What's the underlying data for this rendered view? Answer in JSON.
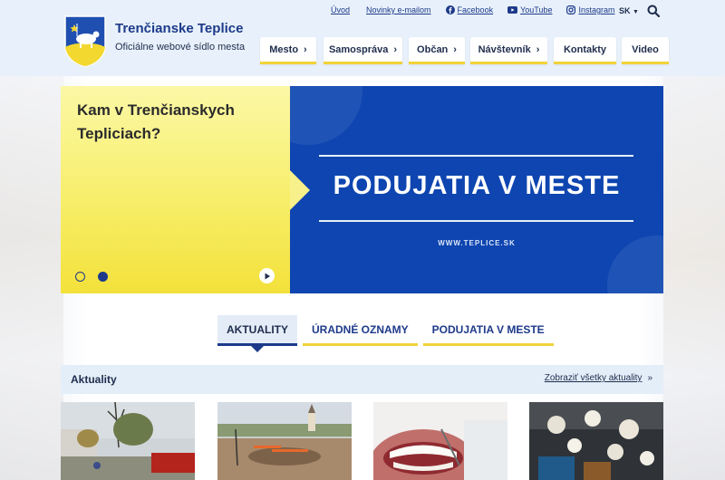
{
  "header": {
    "title": "Trenčianske Teplice",
    "subtitle": "Oficiálne webové sídlo mesta",
    "top_links": [
      "Úvod",
      "Novinky e-mailom",
      "Facebook",
      "YouTube",
      "Instagram"
    ],
    "language": "SK"
  },
  "nav": {
    "items": [
      {
        "label": "Mesto",
        "has_submenu": true
      },
      {
        "label": "Samospráva",
        "has_submenu": true
      },
      {
        "label": "Občan",
        "has_submenu": true
      },
      {
        "label": "Návštevník",
        "has_submenu": true
      },
      {
        "label": "Kontakty",
        "has_submenu": false
      },
      {
        "label": "Video",
        "has_submenu": false
      }
    ]
  },
  "hero": {
    "heading": "Kam v Trenčianskych Tepliciach?",
    "banner_title": "PODUJATIA V MESTE",
    "banner_url": "WWW.TEPLICE.SK",
    "slides": 2,
    "active_slide": 2
  },
  "tabs": {
    "items": [
      "AKTUALITY",
      "ÚRADNÉ OZNAMY",
      "PODUJATIA V MESTE"
    ],
    "active": "AKTUALITY"
  },
  "section": {
    "title": "Aktuality",
    "link": "Zobraziť všetky aktuality"
  },
  "colors": {
    "brand_blue": "#1d3a8a",
    "banner_blue": "#0e45b0",
    "accent_yellow": "#f2d23a",
    "header_bg": "#e8f1fb"
  }
}
